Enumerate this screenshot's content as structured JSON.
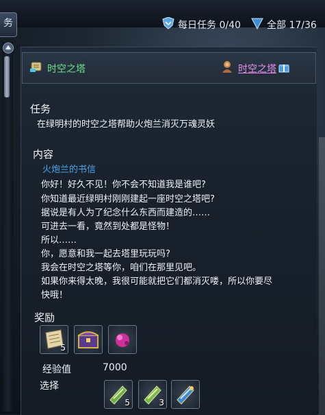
{
  "topbar": {
    "left_tab": "务",
    "daily_quest": "每日任务 0/40",
    "all_quest": "全部 17/36"
  },
  "quest": {
    "name": "时空之塔",
    "location_link": "时空之塔"
  },
  "task": {
    "heading": "任务",
    "text": "在绿明村的时空之塔帮助火炮兰消灭万魂灵妖"
  },
  "content": {
    "heading": "内容",
    "sender": "火炮兰的书信",
    "lines": [
      "你好！好久不见！你不会不知道我是谁吧?",
      "你知道最近绿明村刚刚建起一座时空之塔吧?",
      "据说是有人为了纪念什么东西而建造的……",
      "可进去一看，竟然到处都是怪物！",
      "所以……",
      "你，愿意和我一起去塔里玩玩吗?",
      "我会在时空之塔等你，咱们在那里见吧。",
      "如果你来得太晚，我很可能就把它们都消灭喽，所以你要尽",
      "快哦！"
    ]
  },
  "reward": {
    "heading": "奖励",
    "items": [
      {
        "icon": "scroll-item-icon",
        "count": "5"
      },
      {
        "icon": "treasure-chest-icon",
        "count": ""
      },
      {
        "icon": "pink-gem-icon",
        "count": ""
      }
    ],
    "exp_label": "经验值",
    "exp_value": "7000",
    "choice_label": "选择",
    "choices": [
      {
        "icon": "green-scroll-icon",
        "count": "5"
      },
      {
        "icon": "green-scroll-icon",
        "count": "3"
      },
      {
        "icon": "blue-scroll-icon",
        "count": ""
      }
    ]
  },
  "colors": {
    "quest_name": "#6fe08a",
    "location_link": "#e88ee8",
    "sender": "#4aa4e8"
  }
}
